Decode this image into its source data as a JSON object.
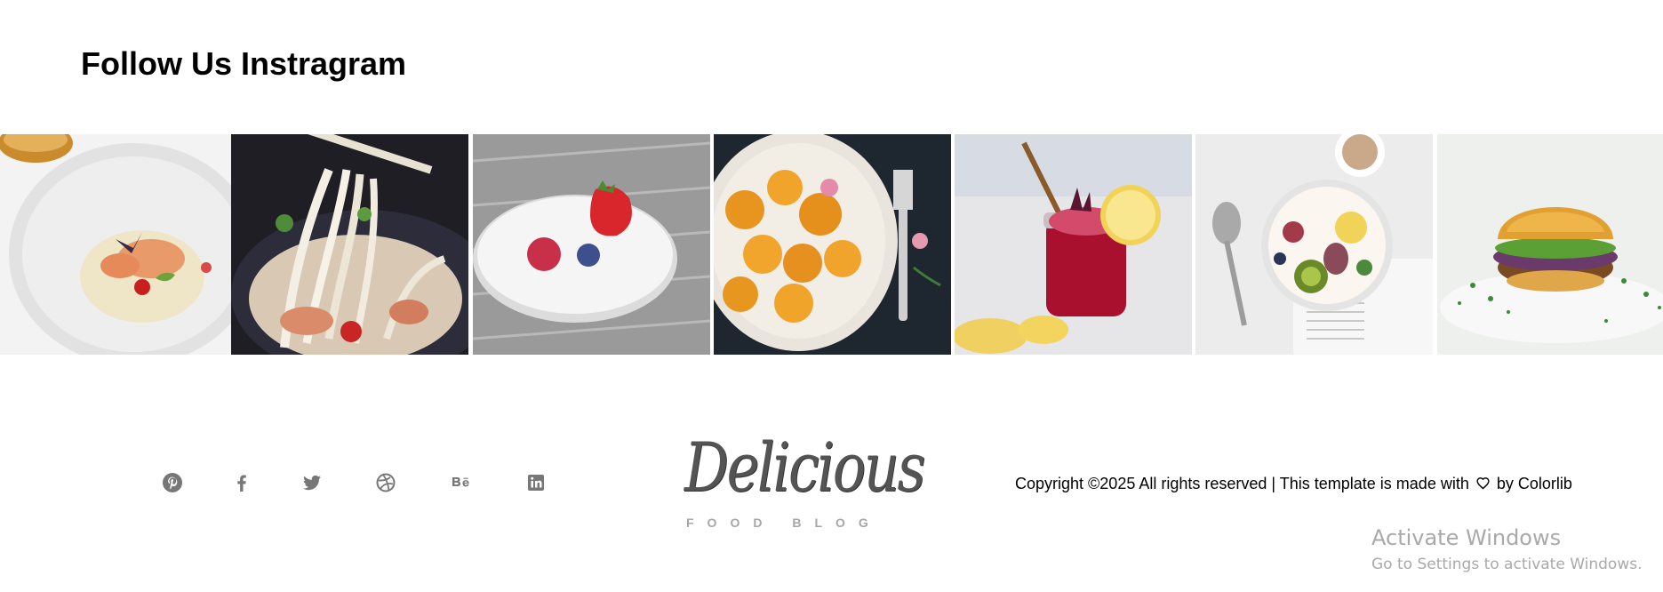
{
  "instagram": {
    "title": "Follow Us Instragram",
    "images": [
      {
        "alt": "shrimp in cream sauce on white plate"
      },
      {
        "alt": "noodles with chopsticks"
      },
      {
        "alt": "berries on white plate"
      },
      {
        "alt": "apricots on decorative plate with fork"
      },
      {
        "alt": "berry drink in jar with lemon"
      },
      {
        "alt": "yogurt bowl with figs and kiwi"
      },
      {
        "alt": "burger on white plate"
      }
    ]
  },
  "footer": {
    "social": [
      {
        "icon": "pinterest-icon"
      },
      {
        "icon": "facebook-icon"
      },
      {
        "icon": "twitter-icon"
      },
      {
        "icon": "dribbble-icon"
      },
      {
        "icon": "behance-icon"
      },
      {
        "icon": "linkedin-icon"
      }
    ],
    "logo": {
      "title": "Delicious",
      "subtitle": "FOOD BLOG"
    },
    "copyright": {
      "prefix": "Copyright ©2025 All rights reserved | This template is made with",
      "by": "by",
      "link": "Colorlib"
    }
  },
  "os_watermark": {
    "title": "Activate Windows",
    "subtitle": "Go to Settings to activate Windows."
  },
  "colors": {
    "social_icon": "#777777",
    "logo": "#545454",
    "logo_subtitle": "#a6a6a6",
    "watermark": "#a9a9a9"
  }
}
